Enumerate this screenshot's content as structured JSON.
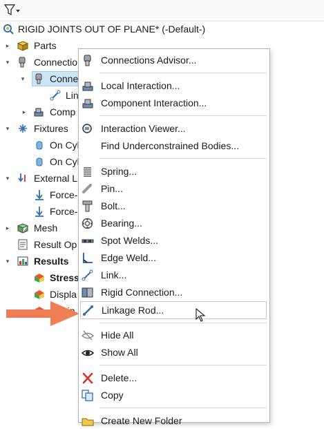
{
  "tree": {
    "root": "RIGID JOINTS OUT OF PLANE* (-Default-)",
    "items": [
      {
        "label": "Parts"
      },
      {
        "label": "Connectio"
      },
      {
        "label": "Connec"
      },
      {
        "label": "Lin"
      },
      {
        "label": "Comp"
      },
      {
        "label": "Fixtures"
      },
      {
        "label": "On Cyl"
      },
      {
        "label": "On Cyl"
      },
      {
        "label": "External L"
      },
      {
        "label": "Force-"
      },
      {
        "label": "Force-"
      },
      {
        "label": "Mesh"
      },
      {
        "label": "Result Op"
      },
      {
        "label": "Results"
      },
      {
        "label": "Stress"
      },
      {
        "label": "Displa"
      },
      {
        "label": "Strain"
      }
    ]
  },
  "menu": {
    "items": [
      {
        "label": "Connections Advisor...",
        "icon": "connections-advisor-icon"
      },
      {
        "label": "Local Interaction...",
        "icon": "local-interaction-icon"
      },
      {
        "label": "Component Interaction...",
        "icon": "component-interaction-icon"
      },
      {
        "label": "Interaction Viewer...",
        "icon": "interaction-viewer-icon"
      },
      {
        "label": "Find Underconstrained Bodies...",
        "icon": ""
      },
      {
        "label": "Spring...",
        "icon": "spring-icon"
      },
      {
        "label": "Pin...",
        "icon": "pin-icon"
      },
      {
        "label": "Bolt...",
        "icon": "bolt-icon"
      },
      {
        "label": "Bearing...",
        "icon": "bearing-icon"
      },
      {
        "label": "Spot Welds...",
        "icon": "spot-welds-icon"
      },
      {
        "label": "Edge Weld...",
        "icon": "edge-weld-icon"
      },
      {
        "label": "Link...",
        "icon": "link-icon"
      },
      {
        "label": "Rigid Connection...",
        "icon": "rigid-connection-icon"
      },
      {
        "label": "Linkage Rod...",
        "icon": "linkage-rod-icon"
      },
      {
        "label": "Hide All",
        "icon": "hide-all-icon"
      },
      {
        "label": "Show All",
        "icon": "show-all-icon"
      },
      {
        "label": "Delete...",
        "icon": "delete-icon"
      },
      {
        "label": "Copy",
        "icon": "copy-icon"
      },
      {
        "label": "Create New Folder",
        "icon": "new-folder-icon"
      }
    ],
    "highlighted": "Linkage Rod..."
  },
  "colors": {
    "accent_arrow": "#ef7d55",
    "selection": "#cde6f7",
    "delete_red": "#d9302b"
  }
}
